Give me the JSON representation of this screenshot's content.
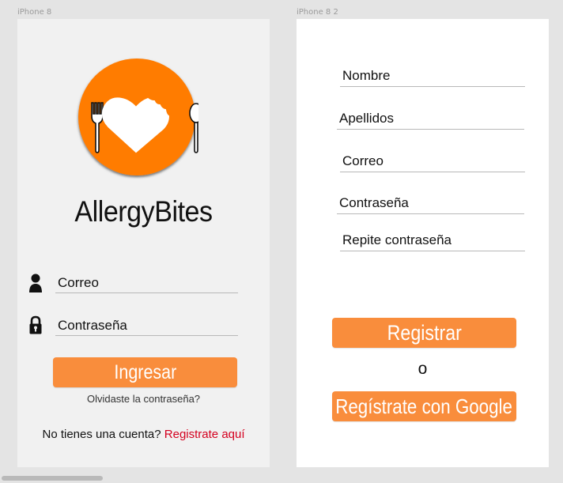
{
  "artboards": {
    "login_label": "iPhone 8",
    "register_label": "iPhone 8 2"
  },
  "login": {
    "logo_icon": "allergybites-logo",
    "app_title": "AllergyBites",
    "email_placeholder": "Correo",
    "password_placeholder": "Contraseña",
    "submit_label": "Ingresar",
    "forgot_label": "Olvidaste la contraseña?",
    "no_account_text": "No tienes una cuenta?",
    "register_link": "Registrate aquí"
  },
  "register": {
    "fields": [
      {
        "placeholder": "Nombre"
      },
      {
        "placeholder": "Apellidos"
      },
      {
        "placeholder": "Correo"
      },
      {
        "placeholder": "Contraseña"
      },
      {
        "placeholder": "Repite contraseña"
      }
    ],
    "submit_label": "Registrar",
    "or_text": "o",
    "google_label": "Regístrate con Google"
  },
  "colors": {
    "accent": "#f98d3c",
    "logo_orange": "#ff7b00",
    "link_red": "#d4001f"
  }
}
